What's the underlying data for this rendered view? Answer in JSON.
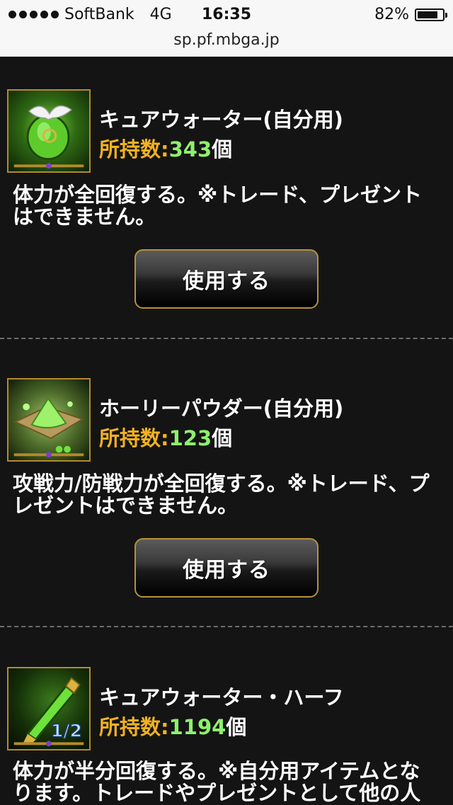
{
  "status_bar": {
    "carrier": "SoftBank",
    "network": "4G",
    "time": "16:35",
    "battery_percent": "82%",
    "battery_level": 0.82,
    "url": "sp.pf.mbga.jp"
  },
  "items": [
    {
      "name": "キュアウォーター(自分用)",
      "count_label": "所持数:",
      "count_value": "343",
      "count_unit": "個",
      "description": "体力が全回復する。※トレード、プレゼントはできません。",
      "button_label": "使用する",
      "icon": "winged-green-potion-icon"
    },
    {
      "name": "ホーリーパウダー(自分用)",
      "count_label": "所持数:",
      "count_value": "123",
      "count_unit": "個",
      "description": "攻戦力/防戦力が全回復する。※トレード、プレゼントはできません。",
      "button_label": "使用する",
      "icon": "green-powder-icon"
    },
    {
      "name": "キュアウォーター・ハーフ",
      "count_label": "所持数:",
      "count_value": "1194",
      "count_unit": "個",
      "description": "体力が半分回復する。※自分用アイテムとなります。トレードやプレゼントとして他の人",
      "icon": "half-potion-vial-icon",
      "icon_badge": "1/2"
    }
  ],
  "colors": {
    "background": "#141414",
    "count_label": "#f2b221",
    "count_value": "#8ef06d",
    "button_border": "#b8913a"
  }
}
